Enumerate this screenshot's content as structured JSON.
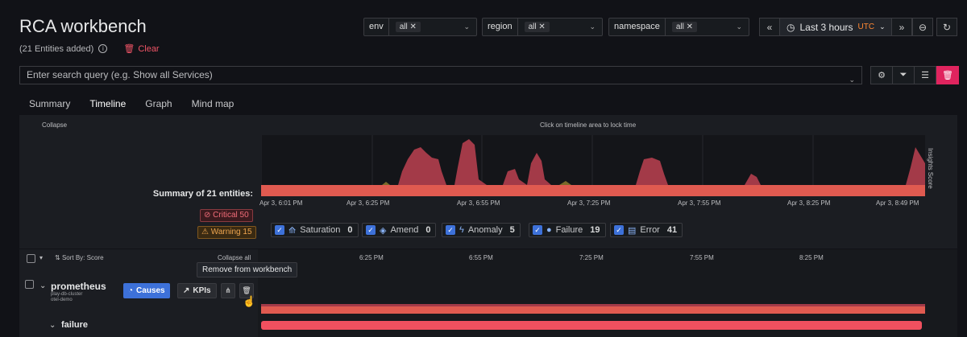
{
  "header": {
    "title": "RCA workbench",
    "entities_added": "(21 Entities added)",
    "clear_label": "Clear"
  },
  "filters": [
    {
      "label": "env",
      "value": "all"
    },
    {
      "label": "region",
      "value": "all"
    },
    {
      "label": "namespace",
      "value": "all"
    }
  ],
  "time_range": {
    "label": "Last 3 hours",
    "tz": "UTC"
  },
  "search": {
    "placeholder": "Enter search query (e.g. Show all Services)"
  },
  "tabs": [
    "Summary",
    "Timeline",
    "Graph",
    "Mind map"
  ],
  "active_tab": "Timeline",
  "summary_panel": {
    "collapse_label": "Collapse",
    "lock_hint": "Click on timeline area to lock time",
    "summary_title": "Summary of 21 entities:",
    "critical": "Critical 50",
    "warning": "Warning 15",
    "side_label": "Insights Score",
    "x_ticks": [
      "Apr 3, 6:01 PM",
      "Apr 3, 6:25 PM",
      "Apr 3, 6:55 PM",
      "Apr 3, 7:25 PM",
      "Apr 3, 7:55 PM",
      "Apr 3, 8:25 PM",
      "Apr 3, 8:49 PM"
    ]
  },
  "legend": [
    {
      "label": "Saturation",
      "count": "0"
    },
    {
      "label": "Amend",
      "count": "0"
    },
    {
      "label": "Anomaly",
      "count": "5"
    },
    {
      "label": "Failure",
      "count": "19"
    },
    {
      "label": "Error",
      "count": "41"
    }
  ],
  "entity_list": {
    "sort_label": "Sort By: Score",
    "collapse_all": "Collapse all",
    "ticks": [
      "6:25 PM",
      "6:55 PM",
      "7:25 PM",
      "7:55 PM",
      "8:25 PM"
    ],
    "tooltip": "Remove from workbench",
    "entity": {
      "name": "prometheus",
      "sub1": "play-db-cluster",
      "sub2": "otel-demo",
      "causes_label": "Causes",
      "kpis_label": "KPIs",
      "child": "failure"
    }
  },
  "colors": {
    "accent_tab": "#ff7030",
    "critical": "#f26d79",
    "warning": "#f0a650",
    "primary": "#3d71d9",
    "area_dark": "#a33a48",
    "area_base": "#e05a50"
  }
}
